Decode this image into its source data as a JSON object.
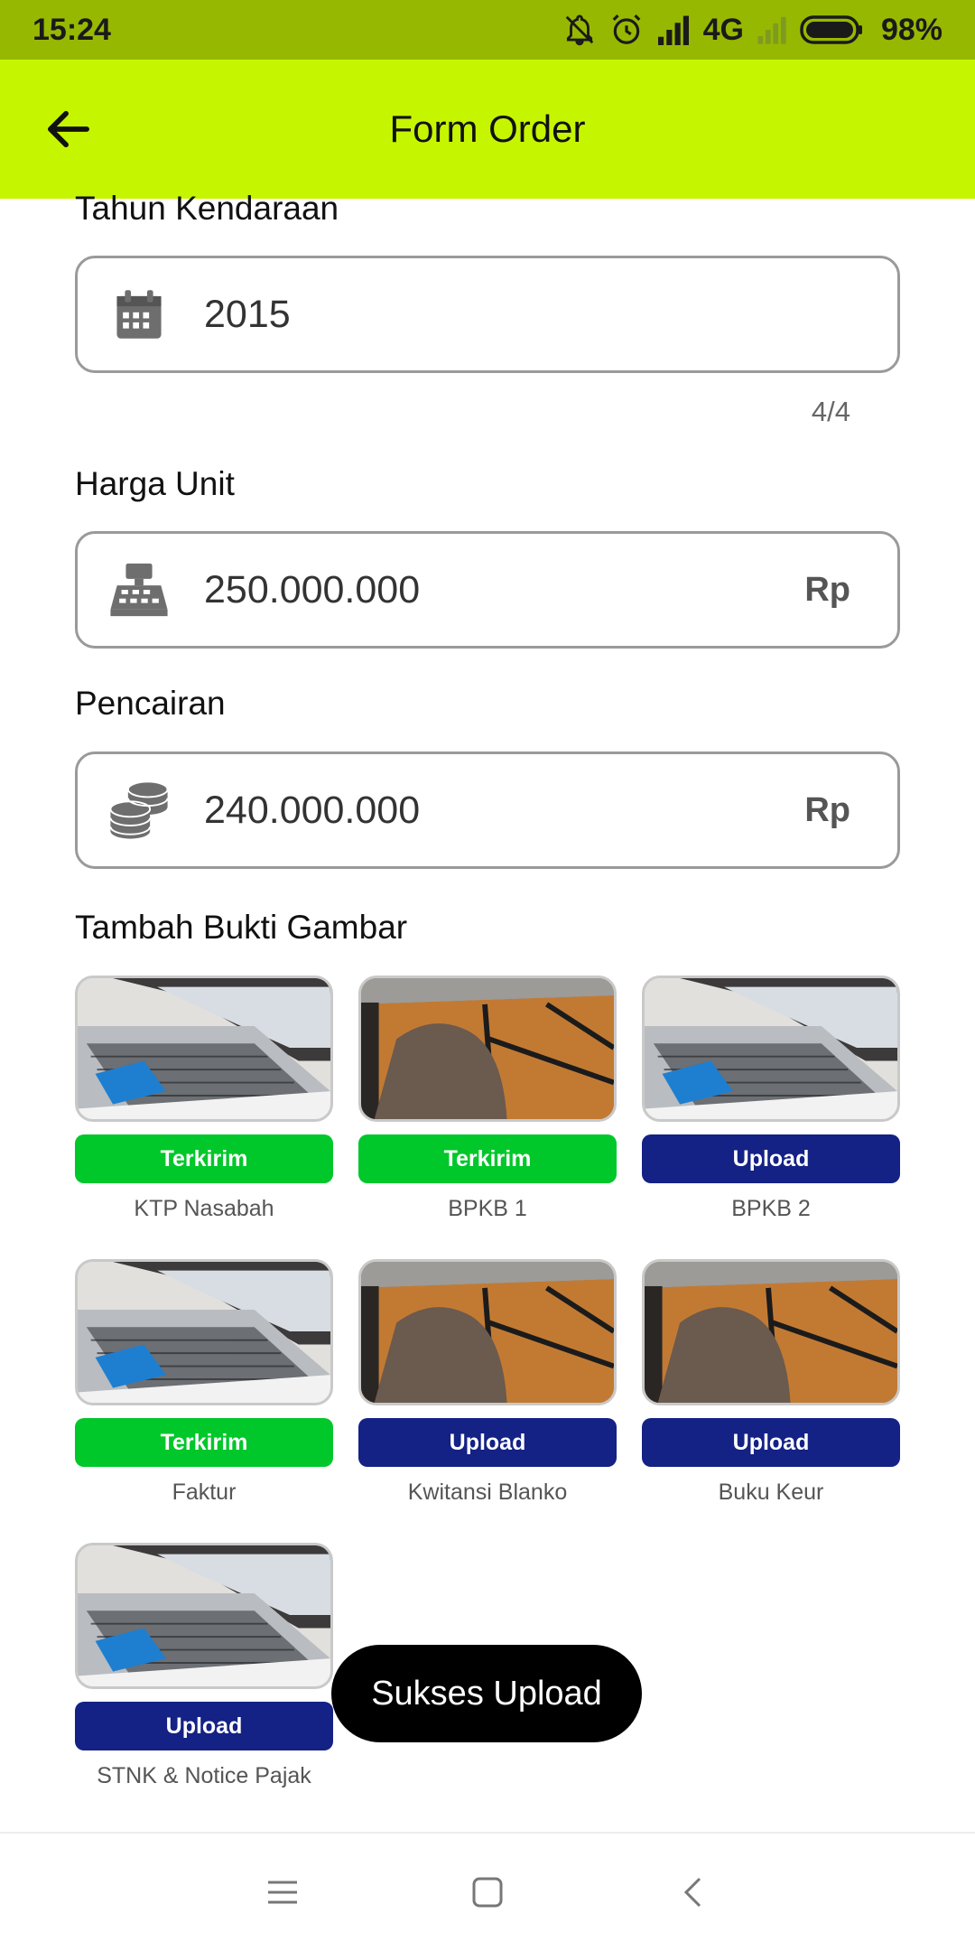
{
  "status_bar": {
    "time": "15:24",
    "network": "4G",
    "battery": "98%"
  },
  "app_bar": {
    "title": "Form Order",
    "back_icon": "arrow-left-icon"
  },
  "form": {
    "year": {
      "label": "Tahun Kendaraan",
      "value": "2015",
      "counter": "4/4",
      "icon": "calendar-icon"
    },
    "unit_price": {
      "label": "Harga Unit",
      "value": "250.000.000",
      "suffix": "Rp",
      "icon": "cash-register-icon"
    },
    "disbursement": {
      "label": "Pencairan",
      "value": "240.000.000",
      "suffix": "Rp",
      "icon": "coins-icon"
    }
  },
  "images_section": {
    "title": "Tambah Bukti Gambar",
    "items": [
      {
        "caption": "KTP Nasabah",
        "button": "Terkirim",
        "status": "sent",
        "photo": "laptop"
      },
      {
        "caption": "BPKB 1",
        "button": "Terkirim",
        "status": "sent",
        "photo": "floor"
      },
      {
        "caption": "BPKB 2",
        "button": "Upload",
        "status": "upload",
        "photo": "laptop"
      },
      {
        "caption": "Faktur",
        "button": "Terkirim",
        "status": "sent",
        "photo": "laptop"
      },
      {
        "caption": "Kwitansi Blanko",
        "button": "Upload",
        "status": "upload",
        "photo": "floor"
      },
      {
        "caption": "Buku Keur",
        "button": "Upload",
        "status": "upload",
        "photo": "floor"
      },
      {
        "caption": "STNK & Notice Pajak",
        "button": "Upload",
        "status": "upload",
        "photo": "laptop"
      }
    ]
  },
  "toast": {
    "message": "Sukses Upload"
  },
  "colors": {
    "app_bar": "#c6f500",
    "status_bar": "#97b800",
    "sent": "#00c72a",
    "upload": "#142185"
  }
}
